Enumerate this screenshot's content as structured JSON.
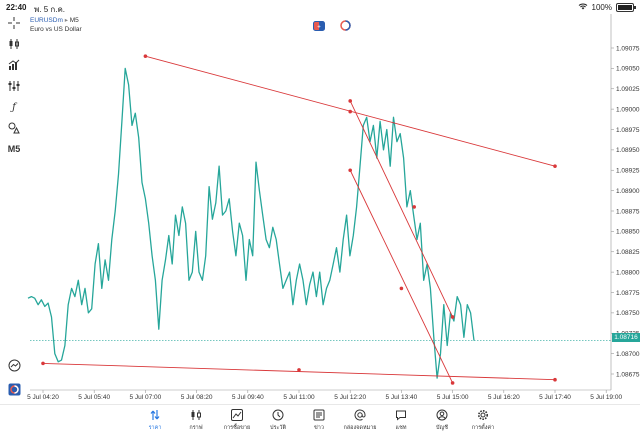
{
  "status_bar": {
    "time": "22:40",
    "date": "พ. 5 ก.ค.",
    "battery": "100%"
  },
  "symbol": {
    "name": "EURUSDm",
    "timeframe": "M5",
    "description": "Euro vs US Dollar"
  },
  "left_toolbar": {
    "timeframe": "M5"
  },
  "current_price": "1.08716",
  "chart_data": {
    "type": "line",
    "y_ticks": [
      "1.09075",
      "1.09050",
      "1.09025",
      "1.09000",
      "1.08975",
      "1.08950",
      "1.08925",
      "1.08900",
      "1.08875",
      "1.08850",
      "1.08825",
      "1.08800",
      "1.08775",
      "1.08750",
      "1.08725",
      "1.08700",
      "1.08675"
    ],
    "x_ticks": [
      "5 Jul 04:20",
      "5 Jul 05:40",
      "5 Jul 07:00",
      "5 Jul 08:20",
      "5 Jul 09:40",
      "5 Jul 11:00",
      "5 Jul 12:20",
      "5 Jul 13:40",
      "5 Jul 15:00",
      "5 Jul 16:20",
      "5 Jul 17:40",
      "5 Jul 19:00"
    ],
    "ylim": [
      1.0866,
      1.0909
    ],
    "series": [
      {
        "color": "#26a69a",
        "values": [
          1.08768,
          1.0877,
          1.08768,
          1.0876,
          1.08766,
          1.08758,
          1.08762,
          1.08745,
          1.087,
          1.0869,
          1.08692,
          1.0871,
          1.0876,
          1.0878,
          1.0877,
          1.0879,
          1.0876,
          1.0878,
          1.0875,
          1.08755,
          1.0881,
          1.08835,
          1.0878,
          1.08815,
          1.0879,
          1.0884,
          1.08875,
          1.0892,
          1.08985,
          1.0905,
          1.0903,
          1.0898,
          1.08995,
          1.08965,
          1.0891,
          1.0889,
          1.0886,
          1.0882,
          1.0879,
          1.0873,
          1.0879,
          1.08815,
          1.08845,
          1.0881,
          1.0887,
          1.08845,
          1.0888,
          1.0886,
          1.0879,
          1.088,
          1.0885,
          1.088,
          1.0879,
          1.0882,
          1.08905,
          1.08865,
          1.08885,
          1.0893,
          1.0887,
          1.08875,
          1.0889,
          1.0885,
          1.0882,
          1.0886,
          1.08845,
          1.0879,
          1.0884,
          1.0882,
          1.08935,
          1.089,
          1.0887,
          1.0884,
          1.0883,
          1.08855,
          1.0884,
          1.0881,
          1.0878,
          1.0879,
          1.088,
          1.0876,
          1.0879,
          1.0881,
          1.0879,
          1.0876,
          1.08785,
          1.088,
          1.0877,
          1.088,
          1.0876,
          1.0878,
          1.0879,
          1.0881,
          1.0883,
          1.088,
          1.0884,
          1.0887,
          1.0882,
          1.08845,
          1.0888,
          1.0893,
          1.0898,
          1.0899,
          1.0896,
          1.0898,
          1.0894,
          1.08985,
          1.0895,
          1.08975,
          1.0893,
          1.0899,
          1.0896,
          1.0897,
          1.0894,
          1.0888,
          1.089,
          1.0887,
          1.0884,
          1.0886,
          1.0879,
          1.0881,
          1.0878,
          1.0872,
          1.0867,
          1.087,
          1.0876,
          1.0871,
          1.0875,
          1.0874,
          1.0877,
          1.0876,
          1.0872,
          1.0876,
          1.0875,
          1.08716
        ]
      }
    ]
  },
  "trendlines": [
    {
      "color": "#d9383a",
      "from": [
        "5 Jul 07:00",
        1.09065
      ],
      "mid": [
        "5 Jul 12:20",
        1.08997
      ],
      "to": [
        "5 Jul 17:40",
        1.0893
      ]
    },
    {
      "color": "#d9383a",
      "from": [
        "5 Jul 04:20",
        1.08688
      ],
      "mid": [
        "5 Jul 11:00",
        1.0868
      ],
      "to": [
        "5 Jul 17:40",
        1.08668
      ]
    },
    {
      "color": "#d9383a",
      "from": [
        "5 Jul 12:20",
        1.08925
      ],
      "mid": [
        "5 Jul 13:40",
        1.0878
      ],
      "to": [
        "5 Jul 15:00",
        1.08664
      ]
    },
    {
      "color": "#d9383a",
      "from": [
        "5 Jul 12:20",
        1.0901
      ],
      "mid": [
        "5 Jul 14:00",
        1.0888
      ],
      "to": [
        "5 Jul 15:00",
        1.08745
      ]
    }
  ],
  "tabs": [
    {
      "label": "ราคา",
      "icon": "price-swap-icon",
      "active": true
    },
    {
      "label": "กราฟ",
      "icon": "candlestick-icon"
    },
    {
      "label": "การซื้อขาย",
      "icon": "trade-chart-icon"
    },
    {
      "label": "ประวัติ",
      "icon": "history-icon"
    },
    {
      "label": "ข่าว",
      "icon": "news-icon"
    },
    {
      "label": "กล่องจดหมาย",
      "icon": "mailbox-icon"
    },
    {
      "label": "แชท",
      "icon": "chat-icon"
    },
    {
      "label": "บัญชี",
      "icon": "account-icon"
    },
    {
      "label": "การตั้งค่า",
      "icon": "settings-icon"
    }
  ]
}
